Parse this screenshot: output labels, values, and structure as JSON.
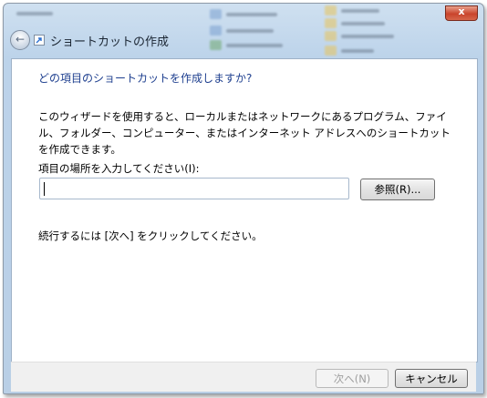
{
  "window": {
    "title": "ショートカットの作成",
    "close_glyph": "x",
    "back_glyph": "←"
  },
  "wizard": {
    "heading": "どの項目のショートカットを作成しますか?",
    "description": "このウィザードを使用すると、ローカルまたはネットワークにあるプログラム、ファイル、フォルダー、コンピューター、またはインターネット アドレスへのショートカットを作成できます。",
    "field_label": "項目の場所を入力してください(I):",
    "location_value": "",
    "browse_label": "参照(R)...",
    "hint": "続行するには [次へ] をクリックしてください。"
  },
  "footer": {
    "next_label": "次へ(N)",
    "cancel_label": "キャンセル"
  },
  "colors": {
    "heading": "#1e3f8f",
    "frame": "#bcd3ea",
    "close_button": "#c9442c"
  }
}
